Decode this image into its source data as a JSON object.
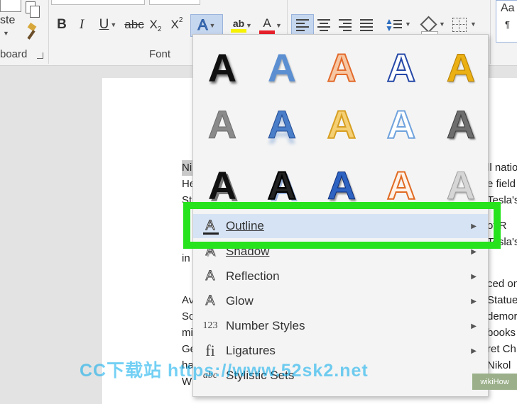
{
  "ribbon": {
    "clipboard_label": "board",
    "paste_partial": "ste",
    "font_label": "Font",
    "buttons": {
      "bold": "B",
      "italic": "I",
      "underline": "U",
      "strike": "abc",
      "subscript": "X",
      "subscript_mark": "2",
      "superscript": "X",
      "superscript_mark": "2",
      "text_effects": "A",
      "highlight": "ab",
      "font_color": "A",
      "pilcrow": "¶",
      "styles_partial": "Aa"
    },
    "colors": {
      "font_color_bar": "#e8202b",
      "highlight_bar": "#f7f300",
      "text_effects": "#4a7ec8"
    }
  },
  "document": {
    "left_lines": [
      "Ni",
      "He",
      "St",
      "",
      "",
      "in",
      "",
      "Av",
      "Sc",
      "mi",
      "Ge",
      "ha",
      "W"
    ],
    "right_lines": [
      "ll natio",
      "e field",
      "Tesla's",
      "",
      "of R",
      "Tesla's",
      "",
      "ced on",
      "Statue",
      "demor",
      "books",
      "ret Ch",
      "Nikol"
    ]
  },
  "effects_gallery": {
    "letter": "A",
    "rows": [
      [
        "black-shadow",
        "blue-gradient",
        "orange-outline",
        "blue-outline",
        "gold"
      ],
      [
        "gray-gradient",
        "blue-reflection",
        "gold-outline",
        "lightblue-outline",
        "gray-bevel"
      ],
      [
        "black-heavy-shadow",
        "black-outline-heavy",
        "blue-heavy-bevel",
        "orange-hollow",
        "silver"
      ]
    ]
  },
  "menu": {
    "items": [
      {
        "label": "Outline",
        "icon": "outline-icon"
      },
      {
        "label": "Shadow",
        "icon": "shadow-icon"
      },
      {
        "label": "Reflection",
        "icon": "reflection-icon"
      },
      {
        "label": "Glow",
        "icon": "glow-icon"
      },
      {
        "label": "Number Styles",
        "icon": "number-styles-icon",
        "icon_text": "123"
      },
      {
        "label": "Ligatures",
        "icon": "ligatures-icon",
        "icon_text": "fi"
      },
      {
        "label": "Stylistic Sets",
        "icon": "stylistic-sets-icon",
        "icon_text": "abc"
      }
    ],
    "highlight_color": "#27e31e"
  },
  "overlay": {
    "watermark": "CC下载站 https://www.52sk2.net",
    "badge": "wikiHow"
  }
}
